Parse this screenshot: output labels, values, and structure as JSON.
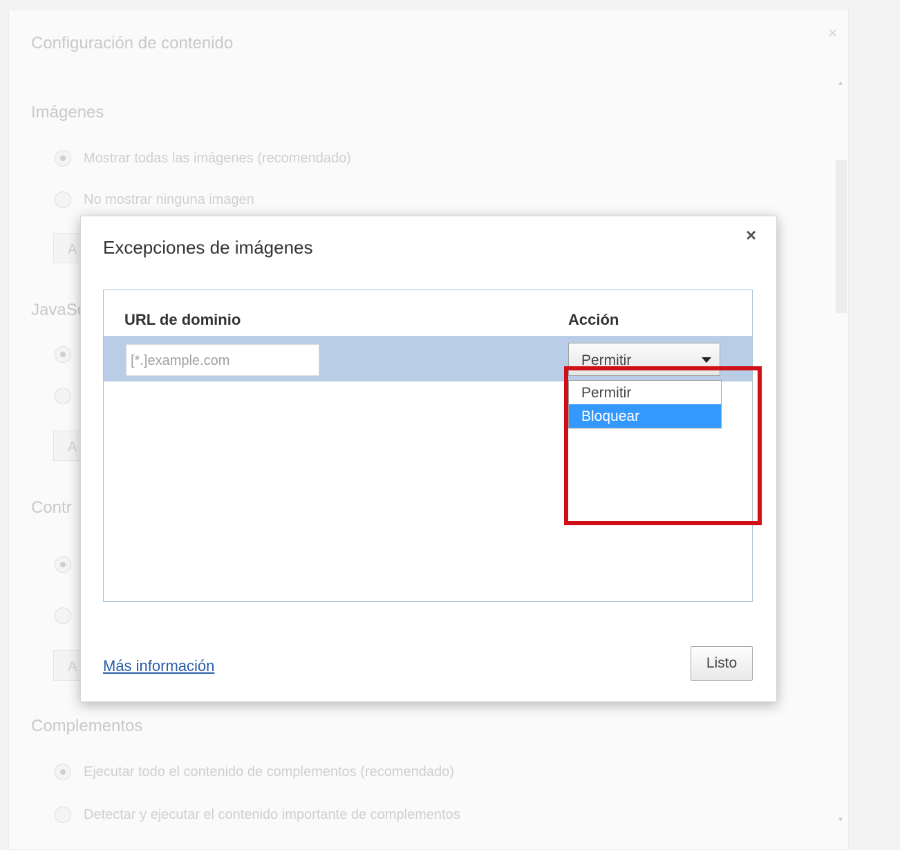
{
  "background": {
    "title": "Configuración de contenido",
    "sections": {
      "images": {
        "heading": "Imágenes",
        "options": [
          "Mostrar todas las imágenes (recomendado)",
          "No mostrar ninguna imagen"
        ],
        "button_label": "A"
      },
      "javascript": {
        "heading": "JavaSc",
        "button_label": "A"
      },
      "controllers": {
        "heading": "Contr",
        "button_label": "A"
      },
      "plugins": {
        "heading": "Complementos",
        "options": [
          "Ejecutar todo el contenido de complementos (recomendado)",
          "Detectar y ejecutar el contenido importante de complementos"
        ]
      }
    },
    "close_symbol": "×"
  },
  "dialog": {
    "title": "Excepciones de imágenes",
    "close_symbol": "×",
    "columns": {
      "domain": "URL de dominio",
      "action": "Acción"
    },
    "row": {
      "domain_placeholder": "[*.]example.com",
      "action_selected": "Permitir"
    },
    "dropdown_options": [
      "Permitir",
      "Bloquear"
    ],
    "highlighted_option": "Bloquear",
    "more_info_link": "Más información",
    "done_button": "Listo"
  },
  "colors": {
    "highlight": "#3399ff",
    "selected_row": "#b9cde6",
    "annotation_frame": "#d10f17",
    "link": "#2a5caa"
  }
}
